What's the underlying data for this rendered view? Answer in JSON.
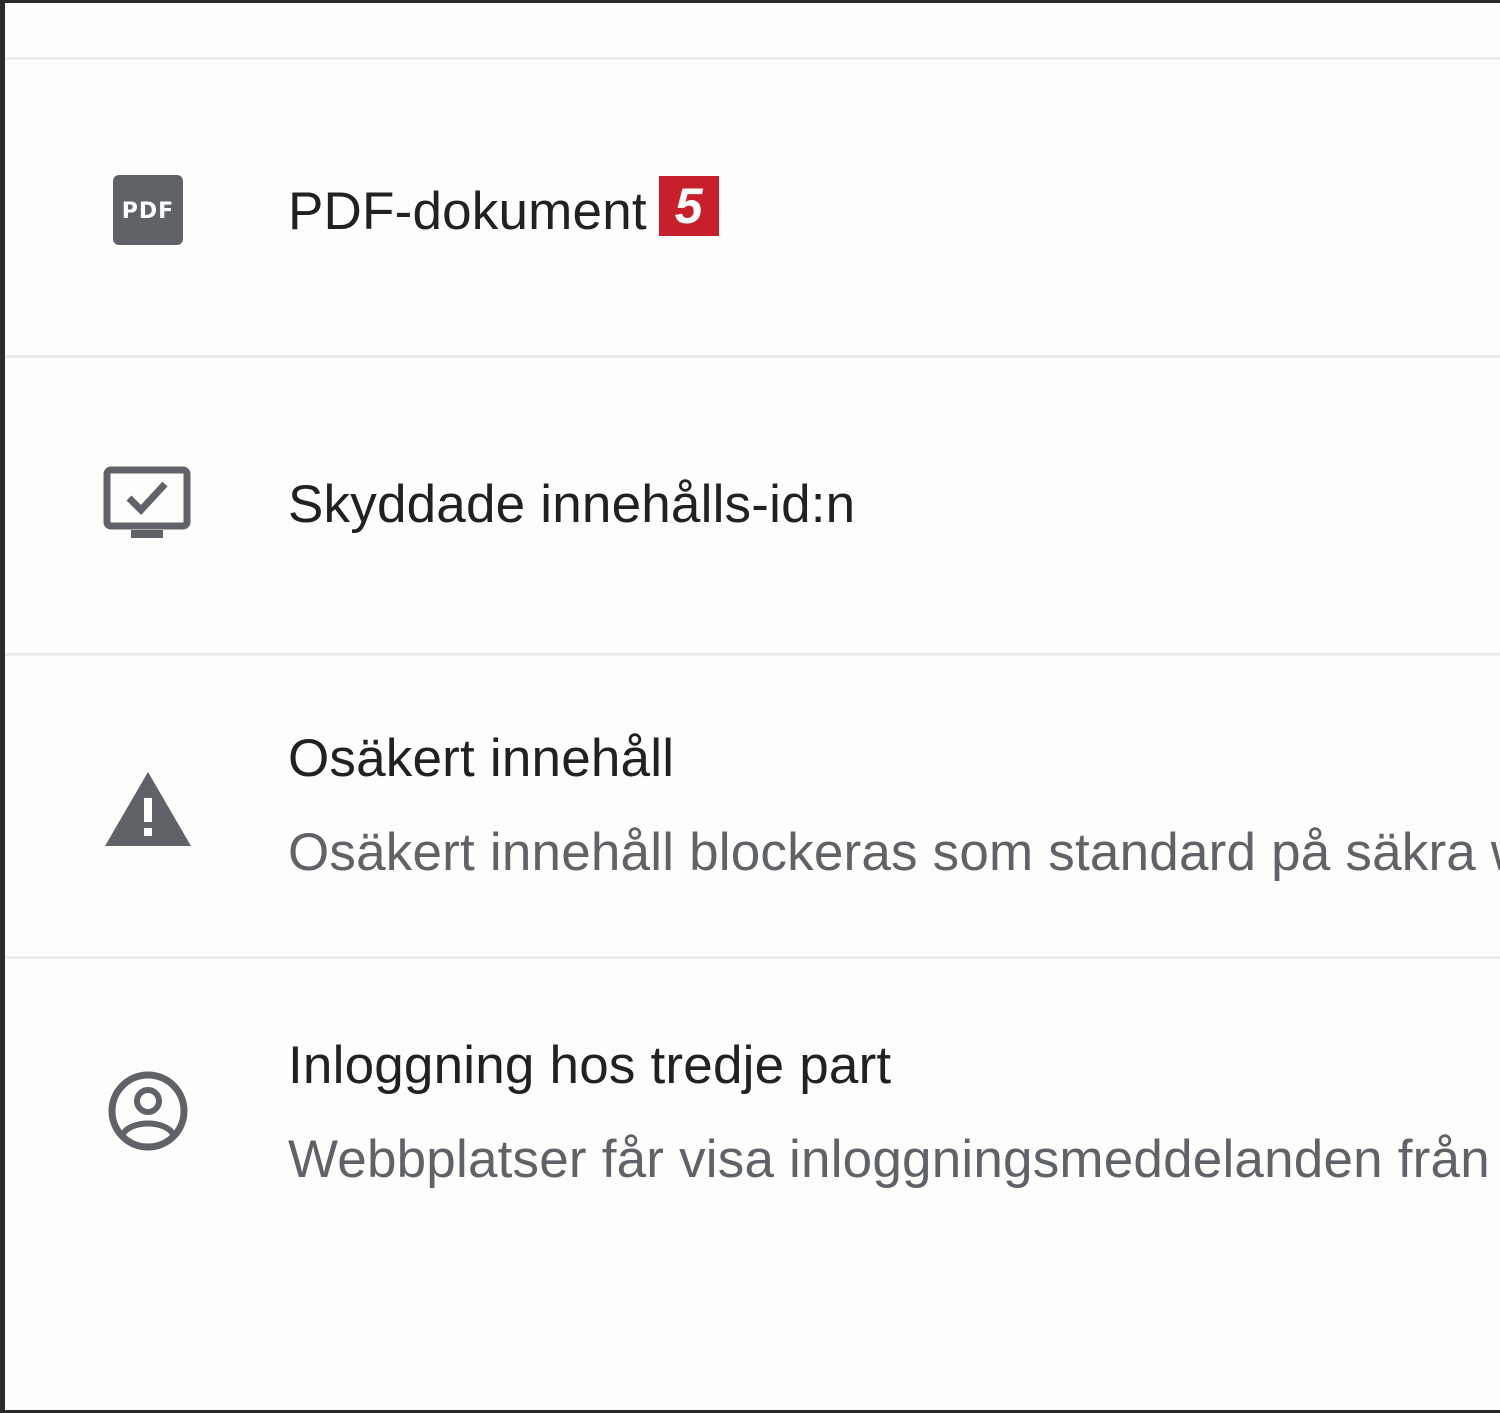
{
  "settings_list": {
    "items": [
      {
        "icon": "pdf-icon",
        "title": "PDF-dokument",
        "badge": "5"
      },
      {
        "icon": "protected-content-icon",
        "title": "Skyddade innehålls-id:n"
      },
      {
        "icon": "warning-icon",
        "title": "Osäkert innehåll",
        "subtitle": "Osäkert innehåll blockeras som standard på säkra webbplatser"
      },
      {
        "icon": "account-circle-icon",
        "title": "Inloggning hos tredje part",
        "subtitle": "Webbplatser får visa inloggningsmeddelanden från identitetstjänster"
      }
    ]
  },
  "colors": {
    "icon": "#5f6368",
    "title": "#202124",
    "subtitle": "#5f6368",
    "badge": "#c8202a",
    "divider": "#ececec"
  }
}
